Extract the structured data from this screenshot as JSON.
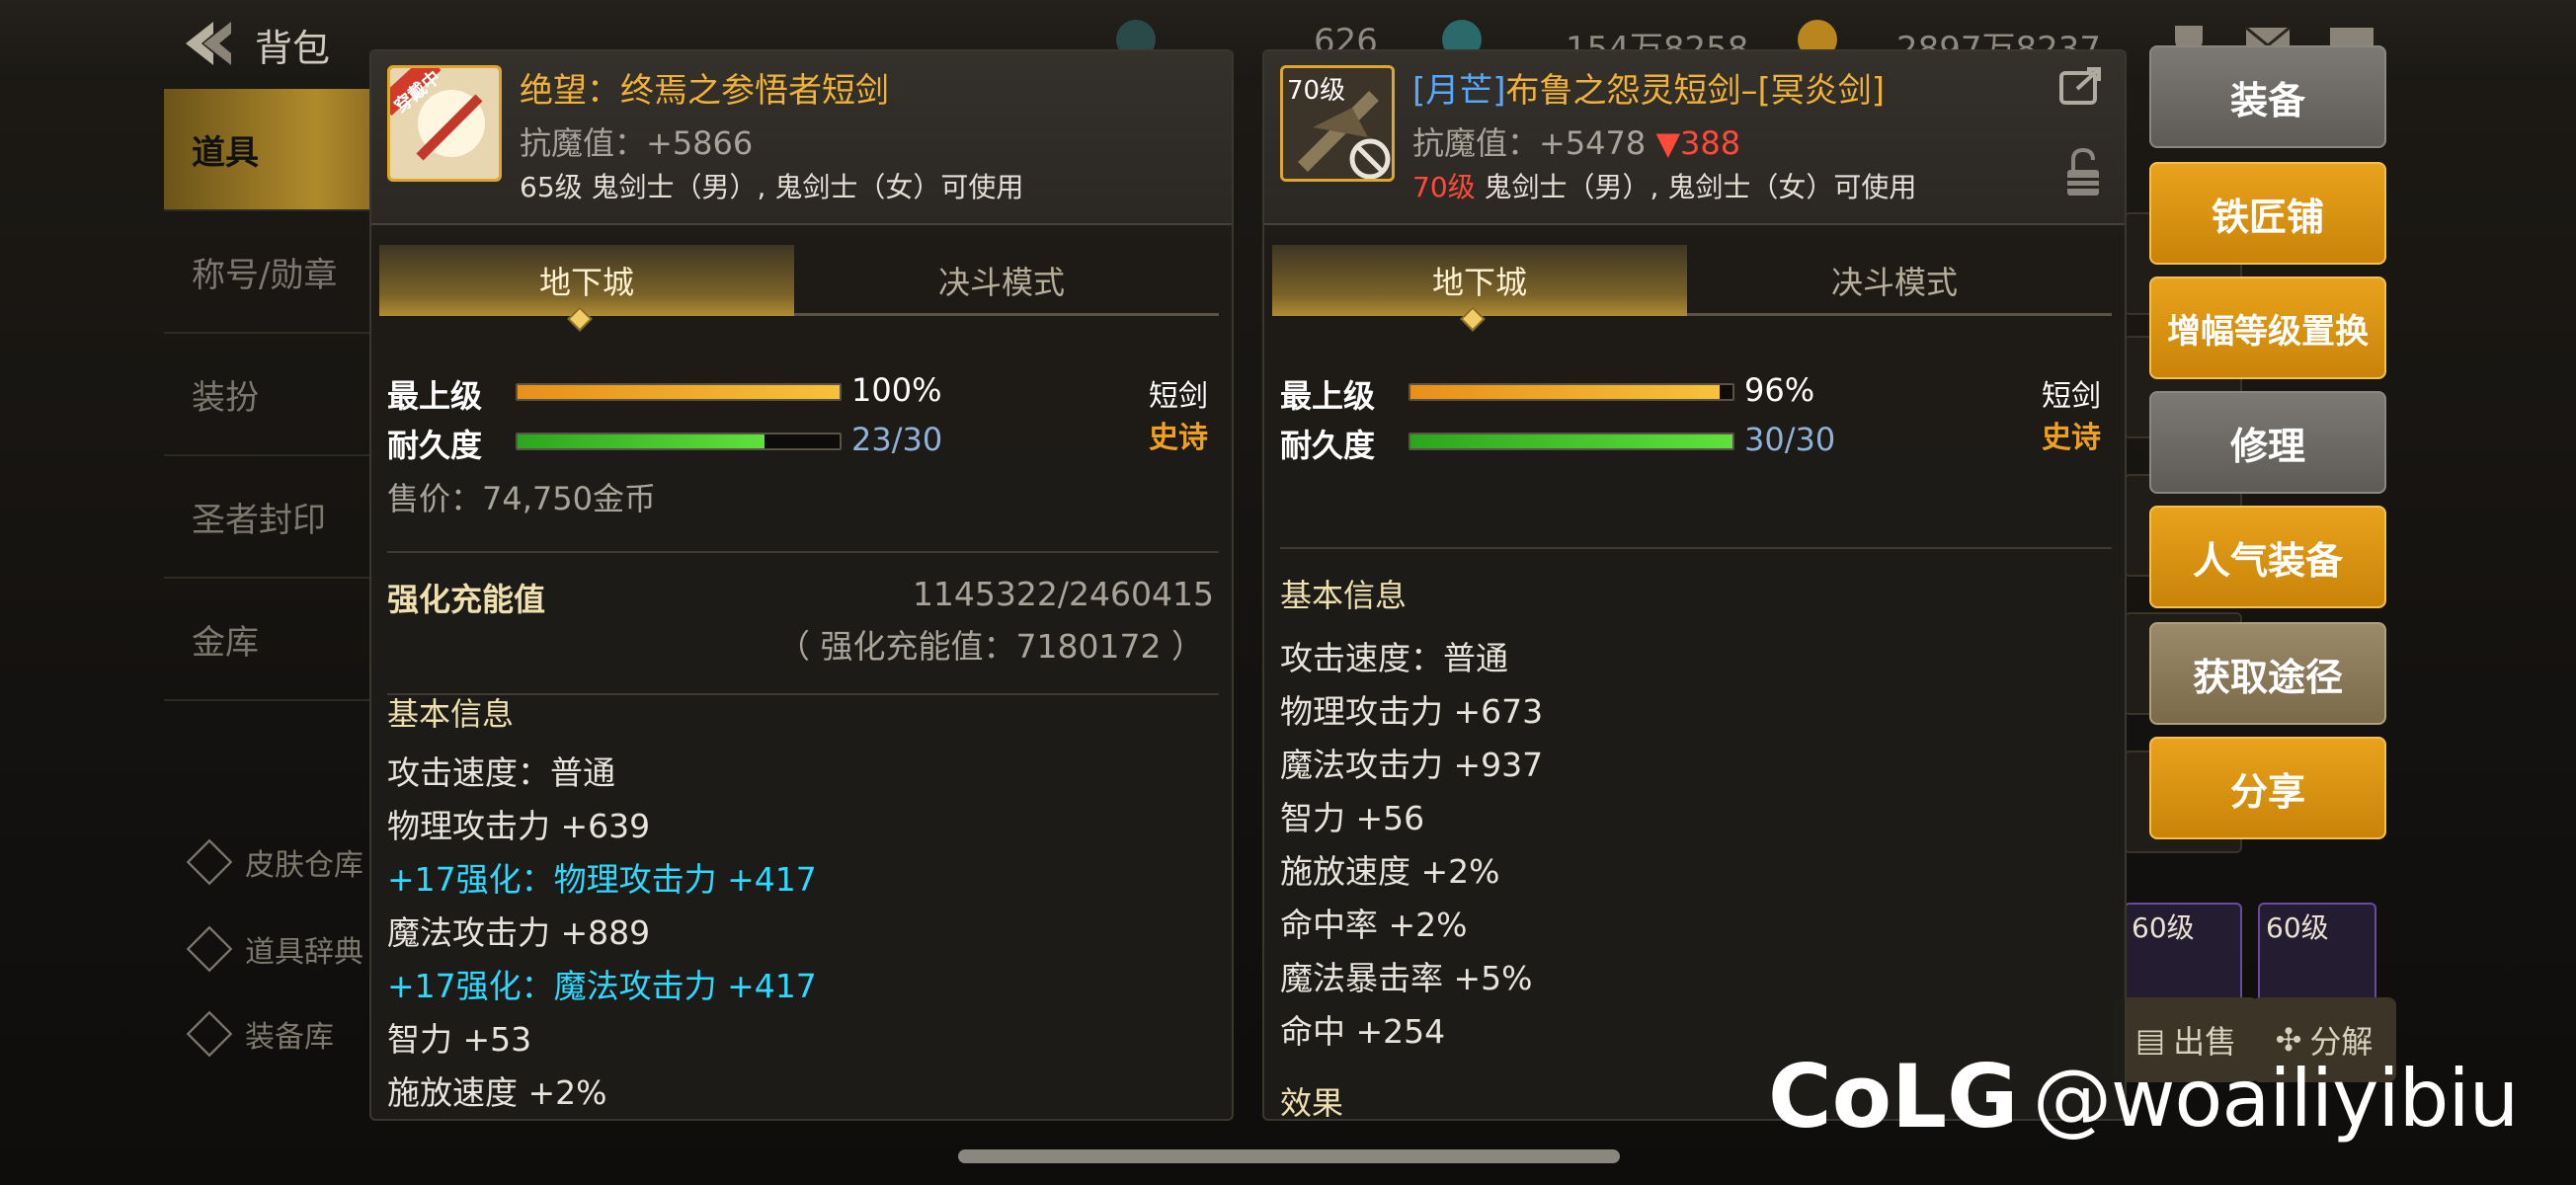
{
  "topbar": {
    "title": "背包",
    "second_tab": "(",
    "currency1": "626",
    "currency2": "154万8258",
    "currency3": "2897万8237"
  },
  "leftnav": {
    "items": [
      "道具",
      "称号/勋章",
      "装扮",
      "圣者封印",
      "金库"
    ],
    "sub_items": [
      "皮肤仓库",
      "道具辞典",
      "装备库"
    ]
  },
  "inventory": {
    "cell_labels": [
      "60级",
      "60级"
    ],
    "sell_button": "出售",
    "decompose_button": "分解"
  },
  "left_item": {
    "badge": "穿戴中",
    "name": "绝望：终焉之参悟者短剑",
    "resist": "抗魔值：+5866",
    "usable": "65级 鬼剑士（男）, 鬼剑士（女）可使用",
    "tab_active": "地下城",
    "tab_inactive": "决斗模式",
    "grade_label": "最上级",
    "grade_value": "100%",
    "grade_fill": 1.0,
    "durability_label": "耐久度",
    "durability_value": "23/30",
    "durability_fill": 0.767,
    "weapon_type": "短剑",
    "rarity": "史诗",
    "price": "售价：74,750金币",
    "charge_title": "强化充能值",
    "charge_value": "1145322/2460415",
    "charge_total": "（ 强化充能值：7180172 ）",
    "basic_title": "基本信息",
    "lines": [
      "攻击速度：普通",
      "物理攻击力 +639",
      "+17强化：物理攻击力 +417",
      "魔法攻击力 +889",
      "+17强化：魔法攻击力 +417",
      "智力 +53",
      "施放速度 +2%"
    ]
  },
  "right_item": {
    "level_badge": "70级",
    "name_prefix": "[月芒]",
    "name": "布鲁之怨灵短剑–[冥炎剑]",
    "resist": "抗魔值：+5478",
    "resist_diff": "▼388",
    "level_req": "70级",
    "usable": " 鬼剑士（男）, 鬼剑士（女）可使用",
    "tab_active": "地下城",
    "tab_inactive": "决斗模式",
    "grade_label": "最上级",
    "grade_value": "96%",
    "grade_fill": 0.96,
    "durability_label": "耐久度",
    "durability_value": "30/30",
    "durability_fill": 1.0,
    "weapon_type": "短剑",
    "rarity": "史诗",
    "basic_title": "基本信息",
    "lines": [
      "攻击速度：普通",
      "物理攻击力 +673",
      "魔法攻击力 +937",
      "智力 +56",
      "施放速度 +2%",
      "命中率 +2%",
      "魔法暴击率 +5%",
      "命中 +254"
    ],
    "effect_title": "效果"
  },
  "actions": [
    "装备",
    "铁匠铺",
    "增幅等级置换",
    "修理",
    "人气装备",
    "获取途径",
    "分享"
  ],
  "watermark": {
    "handle": "@woailiyibiu"
  },
  "colors": {
    "gold_button": "#e09a14",
    "grey_button": "#6e6b66",
    "epic": "#f0b23a",
    "cyan": "#2fd8ff",
    "grade_bar": "#f0a91c",
    "durability_bar": "#3fcf2a"
  }
}
